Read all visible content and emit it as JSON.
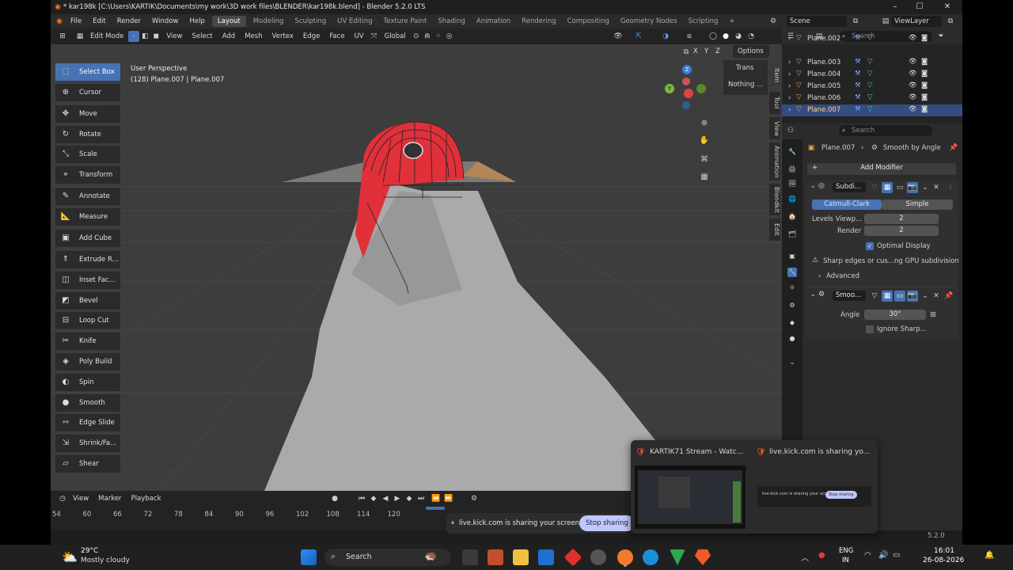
{
  "window": {
    "title": "* kar198k [C:\\Users\\KARTIK\\Documents\\my work\\3D work files\\BLENDER\\kar198k.blend] - Blender 5.2.0 LTS",
    "minimize": "–",
    "maximize": "☐",
    "close": "✕"
  },
  "menu": [
    "File",
    "Edit",
    "Render",
    "Window",
    "Help"
  ],
  "workspaces": [
    "Layout",
    "Modeling",
    "Sculpting",
    "UV Editing",
    "Texture Paint",
    "Shading",
    "Animation",
    "Rendering",
    "Compositing",
    "Geometry Nodes",
    "Scripting"
  ],
  "workspace_add": "+",
  "scene": "Scene",
  "view_layer": "ViewLayer",
  "header": {
    "mode": "Edit Mode",
    "items": [
      "View",
      "Select",
      "Add",
      "Mesh",
      "Vertex",
      "Edge",
      "Face",
      "UV"
    ],
    "transform": "Global"
  },
  "viewport": {
    "perspective": "User Perspective",
    "object_info": "(128) Plane.007 | Plane.007",
    "axes": [
      "X",
      "Y",
      "Z"
    ],
    "options": "Options",
    "npanel_transform": "Trans",
    "npanel_nothing": "Nothing ..."
  },
  "side_tabs": [
    "Item",
    "Tool",
    "View",
    "Animation",
    "Blendkit",
    "Edit"
  ],
  "tools": [
    "Select Box",
    "Cursor",
    "Move",
    "Rotate",
    "Scale",
    "Transform",
    "Annotate",
    "Measure",
    "Add Cube",
    "Extrude R...",
    "Inset Fac...",
    "Bevel",
    "Loop Cut",
    "Knife",
    "Poly Build",
    "Spin",
    "Smooth",
    "Edge Slide",
    "Shrink/Fa...",
    "Shear"
  ],
  "tool_icons": [
    "⬚",
    "⊕",
    "✥",
    "↻",
    "⤡",
    "⌖",
    "✎",
    "📐",
    "▣",
    "⇑",
    "◫",
    "◩",
    "⊟",
    "✂",
    "◈",
    "◐",
    "●",
    "⇿",
    "⇲",
    "▱"
  ],
  "outliner": {
    "search_placeholder": "Search",
    "items": [
      "Plane.002",
      "Plane.003",
      "Plane.004",
      "Plane.005",
      "Plane.006",
      "Plane.007"
    ]
  },
  "properties": {
    "search_placeholder": "Search",
    "object": "Plane.007",
    "modifier_path": "Smooth by Angle",
    "add_modifier": "Add Modifier",
    "subdiv": {
      "name": "Subdi...",
      "catmull": "Catmull-Clark",
      "simple": "Simple",
      "levels_label": "Levels Viewp...",
      "levels_value": "2",
      "render_label": "Render",
      "render_value": "2",
      "optimal": "Optimal Display",
      "warning": "Sharp edges or cus...ng GPU subdivision",
      "advanced": "Advanced"
    },
    "smooth": {
      "name": "Smoo...",
      "angle_label": "Angle",
      "angle_value": "30°",
      "ignore": "Ignore Sharp..."
    }
  },
  "timeline": {
    "menus": [
      "View",
      "Marker",
      "Playback"
    ],
    "ticks": [
      "54",
      "60",
      "66",
      "72",
      "78",
      "84",
      "90",
      "96",
      "102",
      "108",
      "114",
      "120"
    ]
  },
  "version": "5.2.0",
  "share_bar": {
    "text": "live.kick.com is sharing your screen.",
    "stop": "Stop sharing"
  },
  "popup": {
    "tab1": "KARTIK71 Stream - Watc...",
    "tab2": "live.kick.com is sharing yo...",
    "mini_text": "live.kick.com is sharing your screen.",
    "mini_stop": "Stop sharing"
  },
  "taskbar": {
    "weather_temp": "29°C",
    "weather_desc": "Mostly cloudy",
    "search": "Search",
    "lang1": "ENG",
    "lang2": "IN",
    "time": "16:01",
    "date": "26-08-2026"
  },
  "colors": {
    "accent": "#4772b3",
    "selection_red": "#e0303a",
    "viewport_bg": "#3d3d3d"
  }
}
